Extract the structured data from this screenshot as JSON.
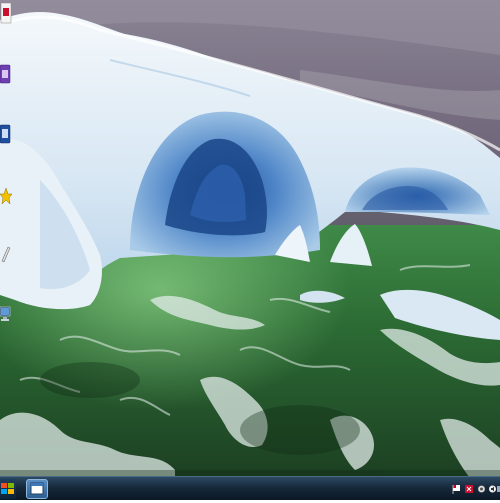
{
  "desktop": {
    "wallpaper": {
      "subject": "iceberg-arch-over-green-sea",
      "colors": {
        "sky": "#7a7285",
        "ice": "#e3eef7",
        "ice_shadow": "#6f9fd0",
        "sea": "#2f6a36",
        "foam": "#dfe9e6"
      }
    },
    "icons": [
      {
        "name": "pdf-document-icon",
        "label": ""
      },
      {
        "name": "purple-app-icon",
        "label": ""
      },
      {
        "name": "blue-app-icon",
        "label": ""
      },
      {
        "name": "star-shortcut-icon",
        "label": ""
      },
      {
        "name": "pen-tool-icon",
        "label": ""
      },
      {
        "name": "computer-icon",
        "label": ""
      }
    ]
  },
  "taskbar": {
    "background": "#17293b",
    "start_button": {
      "icon": "start-icon"
    },
    "pinned_app": {
      "icon": "window-app-icon"
    },
    "tray_icons": [
      "flag-icon",
      "antivirus-icon",
      "network-icon",
      "volume-icon",
      "clock-icon"
    ]
  }
}
